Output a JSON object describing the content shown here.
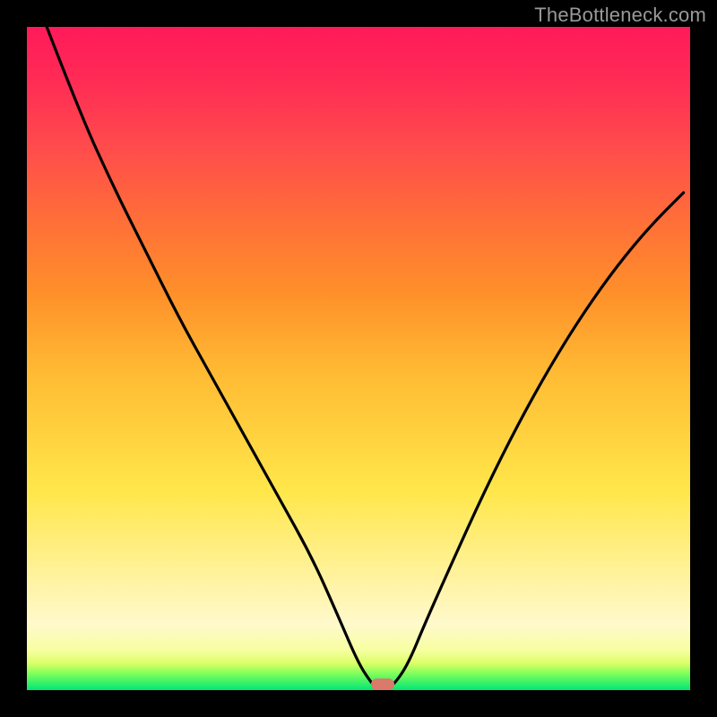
{
  "watermark": "TheBottleneck.com",
  "chart_data": {
    "type": "line",
    "title": "",
    "xlabel": "",
    "ylabel": "",
    "xlim": [
      0,
      1
    ],
    "ylim": [
      0,
      1
    ],
    "series": [
      {
        "name": "curve",
        "x": [
          0.03,
          0.08,
          0.13,
          0.18,
          0.23,
          0.28,
          0.33,
          0.38,
          0.43,
          0.47,
          0.5,
          0.52,
          0.53,
          0.54,
          0.555,
          0.575,
          0.6,
          0.64,
          0.69,
          0.74,
          0.79,
          0.84,
          0.89,
          0.94,
          0.99
        ],
        "y": [
          1.0,
          0.87,
          0.76,
          0.66,
          0.56,
          0.47,
          0.38,
          0.29,
          0.2,
          0.11,
          0.04,
          0.01,
          0.0,
          0.0,
          0.01,
          0.04,
          0.1,
          0.19,
          0.3,
          0.4,
          0.49,
          0.57,
          0.64,
          0.7,
          0.75
        ]
      }
    ],
    "marker": {
      "x": 0.537,
      "y": 0.008
    }
  }
}
